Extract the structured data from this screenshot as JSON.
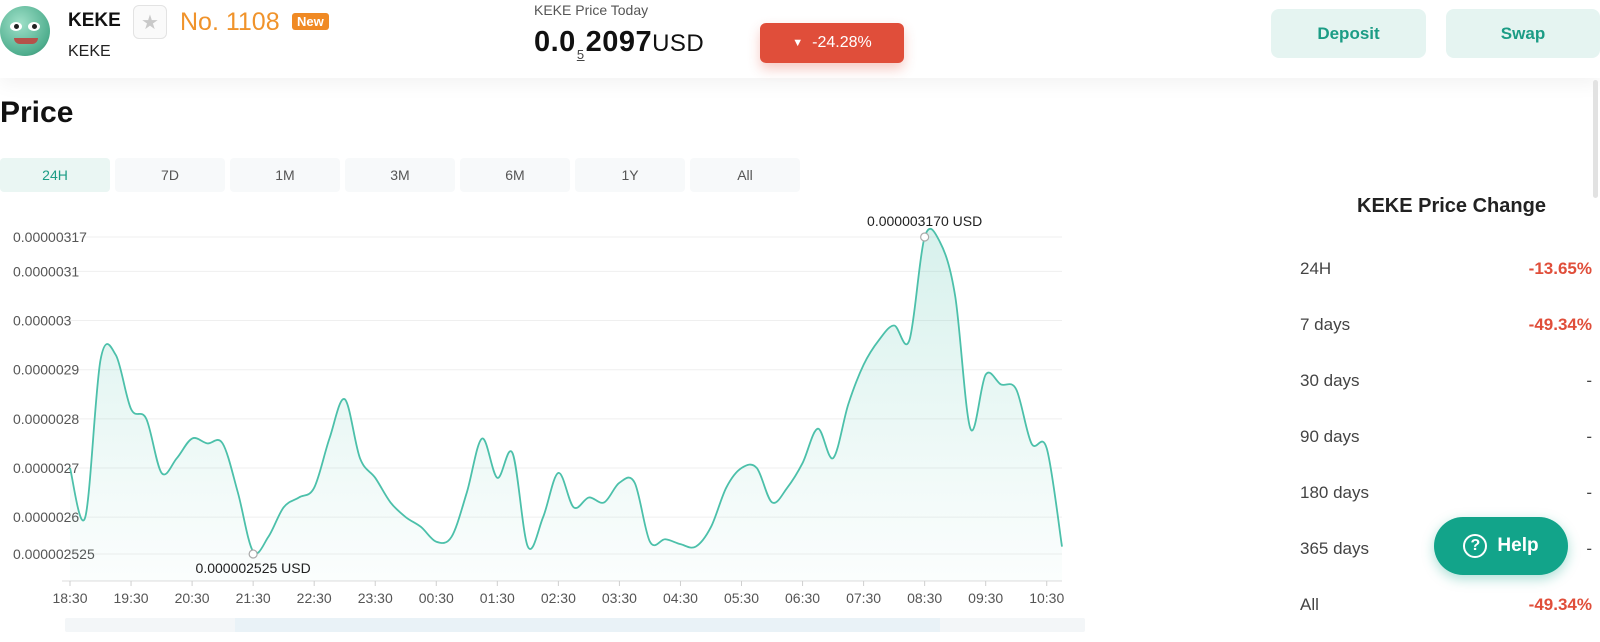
{
  "header": {
    "coin_name": "KEKE",
    "coin_symbol": "KEKE",
    "rank": "No. 1108",
    "new_badge": "New",
    "price_label": "KEKE Price Today",
    "price_prefix": "0.0",
    "price_zero_count": "5",
    "price_digits": "2097",
    "price_unit": "USD",
    "change": "-24.28%",
    "deposit_label": "Deposit",
    "swap_label": "Swap",
    "colors": {
      "accent": "#1b9c85",
      "negative": "#e04e3a",
      "rank": "#f0932b"
    }
  },
  "section_title": "Price",
  "tabs": [
    {
      "label": "24H",
      "active": true
    },
    {
      "label": "7D",
      "active": false
    },
    {
      "label": "1M",
      "active": false
    },
    {
      "label": "3M",
      "active": false
    },
    {
      "label": "6M",
      "active": false
    },
    {
      "label": "1Y",
      "active": false
    },
    {
      "label": "All",
      "active": false
    }
  ],
  "chart_data": {
    "type": "area",
    "title": "",
    "xlabel": "",
    "ylabel": "",
    "color": "#4cc0aa",
    "grid": true,
    "legend": "none",
    "ylim": [
      2.525e-06,
      3.17e-06
    ],
    "y_ticks": [
      {
        "value": 3.17e-06,
        "label": "0.00000317"
      },
      {
        "value": 3.1e-06,
        "label": "0.0000031"
      },
      {
        "value": 3e-06,
        "label": "0.000003"
      },
      {
        "value": 2.9e-06,
        "label": "0.0000029"
      },
      {
        "value": 2.8e-06,
        "label": "0.0000028"
      },
      {
        "value": 2.7e-06,
        "label": "0.0000027"
      },
      {
        "value": 2.6e-06,
        "label": "0.0000026"
      },
      {
        "value": 2.525e-06,
        "label": "0.000002525"
      }
    ],
    "x_ticks": [
      "18:30",
      "19:30",
      "20:30",
      "21:30",
      "22:30",
      "23:30",
      "00:30",
      "01:30",
      "02:30",
      "03:30",
      "04:30",
      "05:30",
      "06:30",
      "07:30",
      "08:30",
      "09:30",
      "10:30"
    ],
    "x_labels": [
      "18:30",
      "18:45",
      "19:00",
      "19:15",
      "19:30",
      "19:45",
      "20:00",
      "20:15",
      "20:30",
      "20:45",
      "21:00",
      "21:15",
      "21:30",
      "21:45",
      "22:00",
      "22:15",
      "22:30",
      "22:45",
      "23:00",
      "23:15",
      "23:30",
      "23:45",
      "00:00",
      "00:15",
      "00:30",
      "00:45",
      "01:00",
      "01:15",
      "01:30",
      "01:45",
      "02:00",
      "02:15",
      "02:30",
      "02:45",
      "03:00",
      "03:15",
      "03:30",
      "03:45",
      "04:00",
      "04:15",
      "04:30",
      "04:45",
      "05:00",
      "05:15",
      "05:30",
      "05:45",
      "06:00",
      "06:15",
      "06:30",
      "06:45",
      "07:00",
      "07:15",
      "07:30",
      "07:45",
      "08:00",
      "08:15",
      "08:30",
      "08:45",
      "09:00",
      "09:15",
      "09:30",
      "09:45",
      "10:00",
      "10:15",
      "10:30",
      "10:45"
    ],
    "values": [
      2.7e-06,
      2.6e-06,
      2.92e-06,
      2.93e-06,
      2.82e-06,
      2.8e-06,
      2.69e-06,
      2.72e-06,
      2.76e-06,
      2.75e-06,
      2.75e-06,
      2.65e-06,
      2.53e-06,
      2.56e-06,
      2.62e-06,
      2.64e-06,
      2.66e-06,
      2.76e-06,
      2.84e-06,
      2.72e-06,
      2.68e-06,
      2.63e-06,
      2.6e-06,
      2.58e-06,
      2.55e-06,
      2.56e-06,
      2.65e-06,
      2.76e-06,
      2.68e-06,
      2.73e-06,
      2.54e-06,
      2.6e-06,
      2.69e-06,
      2.62e-06,
      2.64e-06,
      2.63e-06,
      2.67e-06,
      2.67e-06,
      2.55e-06,
      2.555e-06,
      2.545e-06,
      2.54e-06,
      2.58e-06,
      2.66e-06,
      2.7e-06,
      2.7e-06,
      2.63e-06,
      2.66e-06,
      2.71e-06,
      2.78e-06,
      2.72e-06,
      2.83e-06,
      2.91e-06,
      2.96e-06,
      2.99e-06,
      2.96e-06,
      3.17e-06,
      3.16e-06,
      3.05e-06,
      2.78e-06,
      2.89e-06,
      2.87e-06,
      2.86e-06,
      2.75e-06,
      2.74e-06,
      2.54e-06
    ],
    "annotations": [
      {
        "label": "0.000003170  USD",
        "value": 3.17e-06,
        "time": "08:30",
        "type": "max"
      },
      {
        "label": "0.000002525  USD",
        "value": 2.525e-06,
        "time": "21:30",
        "type": "min"
      }
    ]
  },
  "side_panel": {
    "title": "KEKE Price Change",
    "rows": [
      {
        "label": "24H",
        "value": "-13.65%",
        "negative": true
      },
      {
        "label": "7 days",
        "value": "-49.34%",
        "negative": true
      },
      {
        "label": "30 days",
        "value": "-",
        "negative": false
      },
      {
        "label": "90 days",
        "value": "-",
        "negative": false
      },
      {
        "label": "180 days",
        "value": "-",
        "negative": false
      },
      {
        "label": "365 days",
        "value": "-",
        "negative": false
      },
      {
        "label": "All",
        "value": "-49.34%",
        "negative": true
      }
    ]
  },
  "help_label": "Help"
}
